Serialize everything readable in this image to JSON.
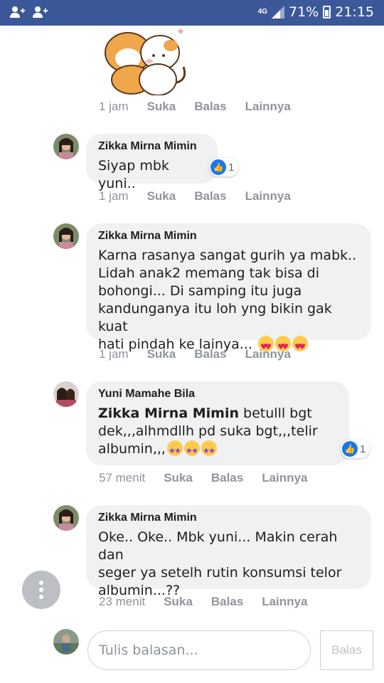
{
  "status_bar": {
    "network": "4G",
    "battery": "71%",
    "time": "21:15"
  },
  "actions": {
    "like": "Suka",
    "reply": "Balas",
    "more": "Lainnya"
  },
  "sticker_meta": {
    "time": "1 jam"
  },
  "comments": [
    {
      "author": "Zikka Mirna Mimin",
      "text": "Siyap mbk yuni..",
      "time": "1 jam",
      "reactions": "1"
    },
    {
      "author": "Zikka Mirna Mimin",
      "lines": [
        "Karna rasanya sangat gurih ya mabk..",
        "Lidah anak2 memang tak bisa di",
        "bohongi... Di samping itu juga",
        "kandunganya itu loh yng bikin gak kuat",
        "hati pindah ke lainya..."
      ],
      "time": "1 jam"
    },
    {
      "author": "Yuni Mamahe Bila",
      "mention": "Zikka Mirna Mimin",
      "line1_rest": " betulll bgt",
      "line2": "dek,,,alhmdllh pd suka bgt,,,telir",
      "line3": "albumin,,,",
      "time": "57 menit",
      "reactions": "1"
    },
    {
      "author": "Zikka Mirna Mimin",
      "lines": [
        "Oke.. Oke.. Mbk yuni... Makin cerah dan",
        "seger ya setelh rutin konsumsi telor",
        "albumin...??"
      ],
      "time": "23 menit"
    }
  ],
  "reply_box": {
    "placeholder": "Tulis balasan...",
    "button": "Balas"
  },
  "colors": {
    "header": "#3b5998",
    "bubble": "#f0f1f3",
    "like": "#1877f2",
    "meta": "#90949c"
  }
}
